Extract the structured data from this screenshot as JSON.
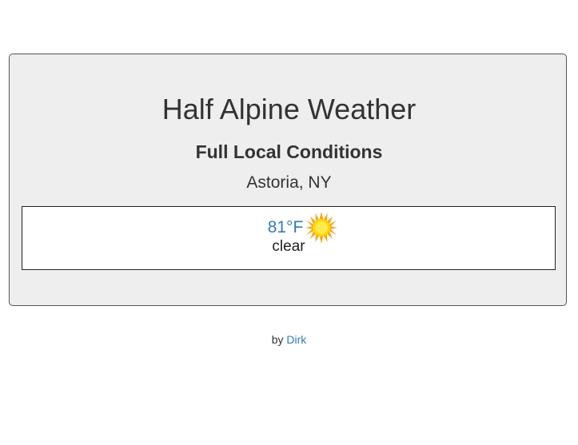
{
  "header": {
    "title": "Half Alpine Weather",
    "subtitle": "Full Local Conditions",
    "location": "Astoria, NY"
  },
  "current": {
    "temperature": "81°F",
    "condition": "clear",
    "icon": "sun-icon",
    "temp_color": "#337ab7"
  },
  "footer": {
    "by_label": "by",
    "author": "Dirk",
    "link_color": "#337ab7"
  },
  "colors": {
    "panel_background": "#eeeeee",
    "text": "#333333",
    "sun_fill": "#ffd700",
    "sun_rays": "#f5a623"
  }
}
